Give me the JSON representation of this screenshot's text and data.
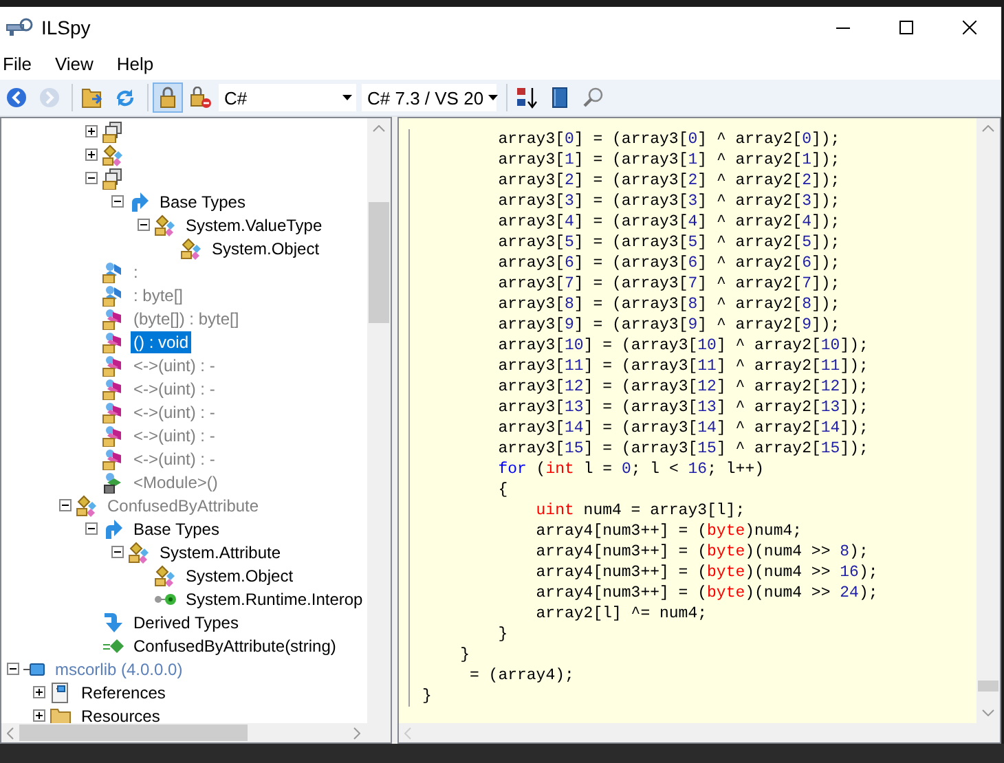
{
  "window": {
    "title": "ILSpy"
  },
  "menu": [
    "File",
    "View",
    "Help"
  ],
  "toolbar": [
    {
      "kind": "button",
      "disabled": false,
      "pressed": false
    },
    {
      "kind": "button",
      "disabled": true,
      "pressed": false
    },
    {
      "kind": "separator"
    },
    {
      "kind": "button",
      "disabled": false,
      "pressed": false
    },
    {
      "kind": "button",
      "disabled": false,
      "pressed": false
    },
    {
      "kind": "separator"
    },
    {
      "kind": "button",
      "disabled": false,
      "pressed": true
    },
    {
      "kind": "button",
      "disabled": false,
      "pressed": false
    },
    {
      "kind": "dropdown",
      "value": "C#"
    },
    {
      "kind": "dropdown",
      "value": "C# 7.3 / VS 20"
    },
    {
      "kind": "separator"
    },
    {
      "kind": "button",
      "disabled": false,
      "pressed": false
    },
    {
      "kind": "button",
      "disabled": false,
      "pressed": false
    },
    {
      "kind": "button",
      "disabled": false,
      "pressed": false
    }
  ],
  "tree": [
    {
      "children": [
        {
          "children": [
            {
              "children": [
                {
                  "kind": "struct",
                  "expanded": false,
                  "selected": false
                },
                {
                  "kind": "class",
                  "expanded": false,
                  "selected": false
                },
                {
                  "kind": "struct",
                  "expanded": true,
                  "selected": false,
                  "children": [
                    {
                      "kind": "base-types",
                      "label": "Base Types",
                      "expanded": true,
                      "selected": false,
                      "dimmed": false,
                      "children": [
                        {
                          "kind": "class",
                          "label": "System.ValueType",
                          "expanded": true,
                          "selected": false,
                          "dimmed": false,
                          "children": [
                            {
                              "kind": "class",
                              "label": "System.Object",
                              "selected": false,
                              "dimmed": false
                            }
                          ]
                        }
                      ]
                    }
                  ]
                },
                {
                  "kind": "field",
                  "label": ":",
                  "selected": false,
                  "dimmed": true
                },
                {
                  "kind": "field",
                  "label": ": byte[]",
                  "selected": false,
                  "dimmed": true
                },
                {
                  "kind": "method",
                  "label": "(byte[]) : byte[]",
                  "selected": false,
                  "dimmed": true
                },
                {
                  "kind": "method",
                  "label": "() : void",
                  "selected": true,
                  "dimmed": true
                },
                {
                  "kind": "method",
                  "label": "<->(uint) : -",
                  "selected": false,
                  "dimmed": true
                },
                {
                  "kind": "method",
                  "label": "<->(uint) : -",
                  "selected": false,
                  "dimmed": true
                },
                {
                  "kind": "method",
                  "label": "<->(uint) : -",
                  "selected": false,
                  "dimmed": true
                },
                {
                  "kind": "method",
                  "label": "<->(uint) : -",
                  "selected": false,
                  "dimmed": true
                },
                {
                  "kind": "method",
                  "label": "<->(uint) : -",
                  "selected": false,
                  "dimmed": true
                },
                {
                  "kind": "module",
                  "label": "<Module>()",
                  "selected": false,
                  "dimmed": true
                }
              ]
            },
            {
              "kind": "class",
              "label": "ConfusedByAttribute",
              "expanded": true,
              "selected": false,
              "dimmed": true,
              "children": [
                {
                  "kind": "base-types",
                  "label": "Base Types",
                  "expanded": true,
                  "selected": false,
                  "dimmed": false,
                  "children": [
                    {
                      "kind": "class",
                      "label": "System.Attribute",
                      "expanded": true,
                      "selected": false,
                      "dimmed": false,
                      "children": [
                        {
                          "kind": "class",
                          "label": "System.Object",
                          "selected": false,
                          "dimmed": false
                        },
                        {
                          "kind": "interface",
                          "label": "System.Runtime.Interop",
                          "selected": false,
                          "dimmed": false
                        }
                      ]
                    }
                  ]
                },
                {
                  "kind": "derived-types",
                  "label": "Derived Types",
                  "selected": false,
                  "dimmed": false
                },
                {
                  "kind": "constructor",
                  "label": "ConfusedByAttribute(string)",
                  "selected": false,
                  "dimmed": false
                }
              ]
            }
          ]
        }
      ]
    },
    {
      "kind": "assembly",
      "label": "mscorlib (4.0.0.0)",
      "expanded": true,
      "selected": false,
      "children": [
        {
          "kind": "references",
          "label": "References",
          "expanded": false,
          "selected": false,
          "dimmed": false
        },
        {
          "kind": "folder",
          "label": "Resources",
          "expanded": false,
          "selected": false,
          "dimmed": false
        }
      ]
    }
  ],
  "code": [
    {
      "children": [
        {
          "children": [
            [
              "array3[",
              {
                "text": "0",
                "kind": "number"
              },
              "] = (array3[",
              {
                "text": "0",
                "kind": "number"
              },
              "] ^ array2[",
              {
                "text": "0",
                "kind": "number"
              },
              "]);"
            ],
            [
              "array3[",
              {
                "text": "1",
                "kind": "number"
              },
              "] = (array3[",
              {
                "text": "1",
                "kind": "number"
              },
              "] ^ array2[",
              {
                "text": "1",
                "kind": "number"
              },
              "]);"
            ],
            [
              "array3[",
              {
                "text": "2",
                "kind": "number"
              },
              "] = (array3[",
              {
                "text": "2",
                "kind": "number"
              },
              "] ^ array2[",
              {
                "text": "2",
                "kind": "number"
              },
              "]);"
            ],
            [
              "array3[",
              {
                "text": "3",
                "kind": "number"
              },
              "] = (array3[",
              {
                "text": "3",
                "kind": "number"
              },
              "] ^ array2[",
              {
                "text": "3",
                "kind": "number"
              },
              "]);"
            ],
            [
              "array3[",
              {
                "text": "4",
                "kind": "number"
              },
              "] = (array3[",
              {
                "text": "4",
                "kind": "number"
              },
              "] ^ array2[",
              {
                "text": "4",
                "kind": "number"
              },
              "]);"
            ],
            [
              "array3[",
              {
                "text": "5",
                "kind": "number"
              },
              "] = (array3[",
              {
                "text": "5",
                "kind": "number"
              },
              "] ^ array2[",
              {
                "text": "5",
                "kind": "number"
              },
              "]);"
            ],
            [
              "array3[",
              {
                "text": "6",
                "kind": "number"
              },
              "] = (array3[",
              {
                "text": "6",
                "kind": "number"
              },
              "] ^ array2[",
              {
                "text": "6",
                "kind": "number"
              },
              "]);"
            ],
            [
              "array3[",
              {
                "text": "7",
                "kind": "number"
              },
              "] = (array3[",
              {
                "text": "7",
                "kind": "number"
              },
              "] ^ array2[",
              {
                "text": "7",
                "kind": "number"
              },
              "]);"
            ],
            [
              "array3[",
              {
                "text": "8",
                "kind": "number"
              },
              "] = (array3[",
              {
                "text": "8",
                "kind": "number"
              },
              "] ^ array2[",
              {
                "text": "8",
                "kind": "number"
              },
              "]);"
            ],
            [
              "array3[",
              {
                "text": "9",
                "kind": "number"
              },
              "] = (array3[",
              {
                "text": "9",
                "kind": "number"
              },
              "] ^ array2[",
              {
                "text": "9",
                "kind": "number"
              },
              "]);"
            ],
            [
              "array3[",
              {
                "text": "10",
                "kind": "number"
              },
              "] = (array3[",
              {
                "text": "10",
                "kind": "number"
              },
              "] ^ array2[",
              {
                "text": "10",
                "kind": "number"
              },
              "]);"
            ],
            [
              "array3[",
              {
                "text": "11",
                "kind": "number"
              },
              "] = (array3[",
              {
                "text": "11",
                "kind": "number"
              },
              "] ^ array2[",
              {
                "text": "11",
                "kind": "number"
              },
              "]);"
            ],
            [
              "array3[",
              {
                "text": "12",
                "kind": "number"
              },
              "] = (array3[",
              {
                "text": "12",
                "kind": "number"
              },
              "] ^ array2[",
              {
                "text": "12",
                "kind": "number"
              },
              "]);"
            ],
            [
              "array3[",
              {
                "text": "13",
                "kind": "number"
              },
              "] = (array3[",
              {
                "text": "13",
                "kind": "number"
              },
              "] ^ array2[",
              {
                "text": "13",
                "kind": "number"
              },
              "]);"
            ],
            [
              "array3[",
              {
                "text": "14",
                "kind": "number"
              },
              "] = (array3[",
              {
                "text": "14",
                "kind": "number"
              },
              "] ^ array2[",
              {
                "text": "14",
                "kind": "number"
              },
              "]);"
            ],
            [
              "array3[",
              {
                "text": "15",
                "kind": "number"
              },
              "] = (array3[",
              {
                "text": "15",
                "kind": "number"
              },
              "] ^ array2[",
              {
                "text": "15",
                "kind": "number"
              },
              "]);"
            ],
            [
              {
                "text": "for",
                "kind": "keyword"
              },
              " (",
              {
                "text": "int",
                "kind": "type"
              },
              " l = ",
              {
                "text": "0",
                "kind": "number"
              },
              "; l < ",
              {
                "text": "16",
                "kind": "number"
              },
              "; l++)"
            ],
            [
              "{"
            ],
            {
              "children": [
                [
                  {
                    "text": "uint",
                    "kind": "type"
                  },
                  " num4 = array3[l];"
                ],
                [
                  "array4[num3++] = (",
                  {
                    "text": "byte",
                    "kind": "type"
                  },
                  ")num4;"
                ],
                [
                  "array4[num3++] = (",
                  {
                    "text": "byte",
                    "kind": "type"
                  },
                  ")(num4 >> ",
                  {
                    "text": "8",
                    "kind": "number"
                  },
                  ");"
                ],
                [
                  "array4[num3++] = (",
                  {
                    "text": "byte",
                    "kind": "type"
                  },
                  ")(num4 >> ",
                  {
                    "text": "16",
                    "kind": "number"
                  },
                  ");"
                ],
                [
                  "array4[num3++] = (",
                  {
                    "text": "byte",
                    "kind": "type"
                  },
                  ")(num4 >> ",
                  {
                    "text": "24",
                    "kind": "number"
                  },
                  ");"
                ],
                [
                  "array2[l] ^= num4;"
                ]
              ]
            },
            [
              "}"
            ]
          ]
        },
        [
          "}"
        ],
        [
          " = (array4);"
        ]
      ]
    },
    [
      "}"
    ]
  ]
}
